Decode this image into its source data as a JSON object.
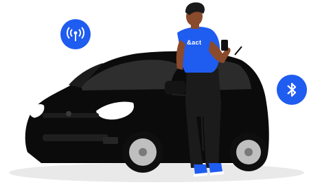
{
  "illustration": {
    "shirt_text": "&act",
    "icons": [
      "wireless-signal-icon",
      "bluetooth-icon"
    ],
    "colors": {
      "accent_blue": "#1f5cf0",
      "car_body": "#0b0b0b",
      "car_shadow": "#e6e6e6",
      "skin": "#8a4a2c",
      "hair": "#1a1a1a",
      "pants": "#1b1b1b"
    }
  }
}
